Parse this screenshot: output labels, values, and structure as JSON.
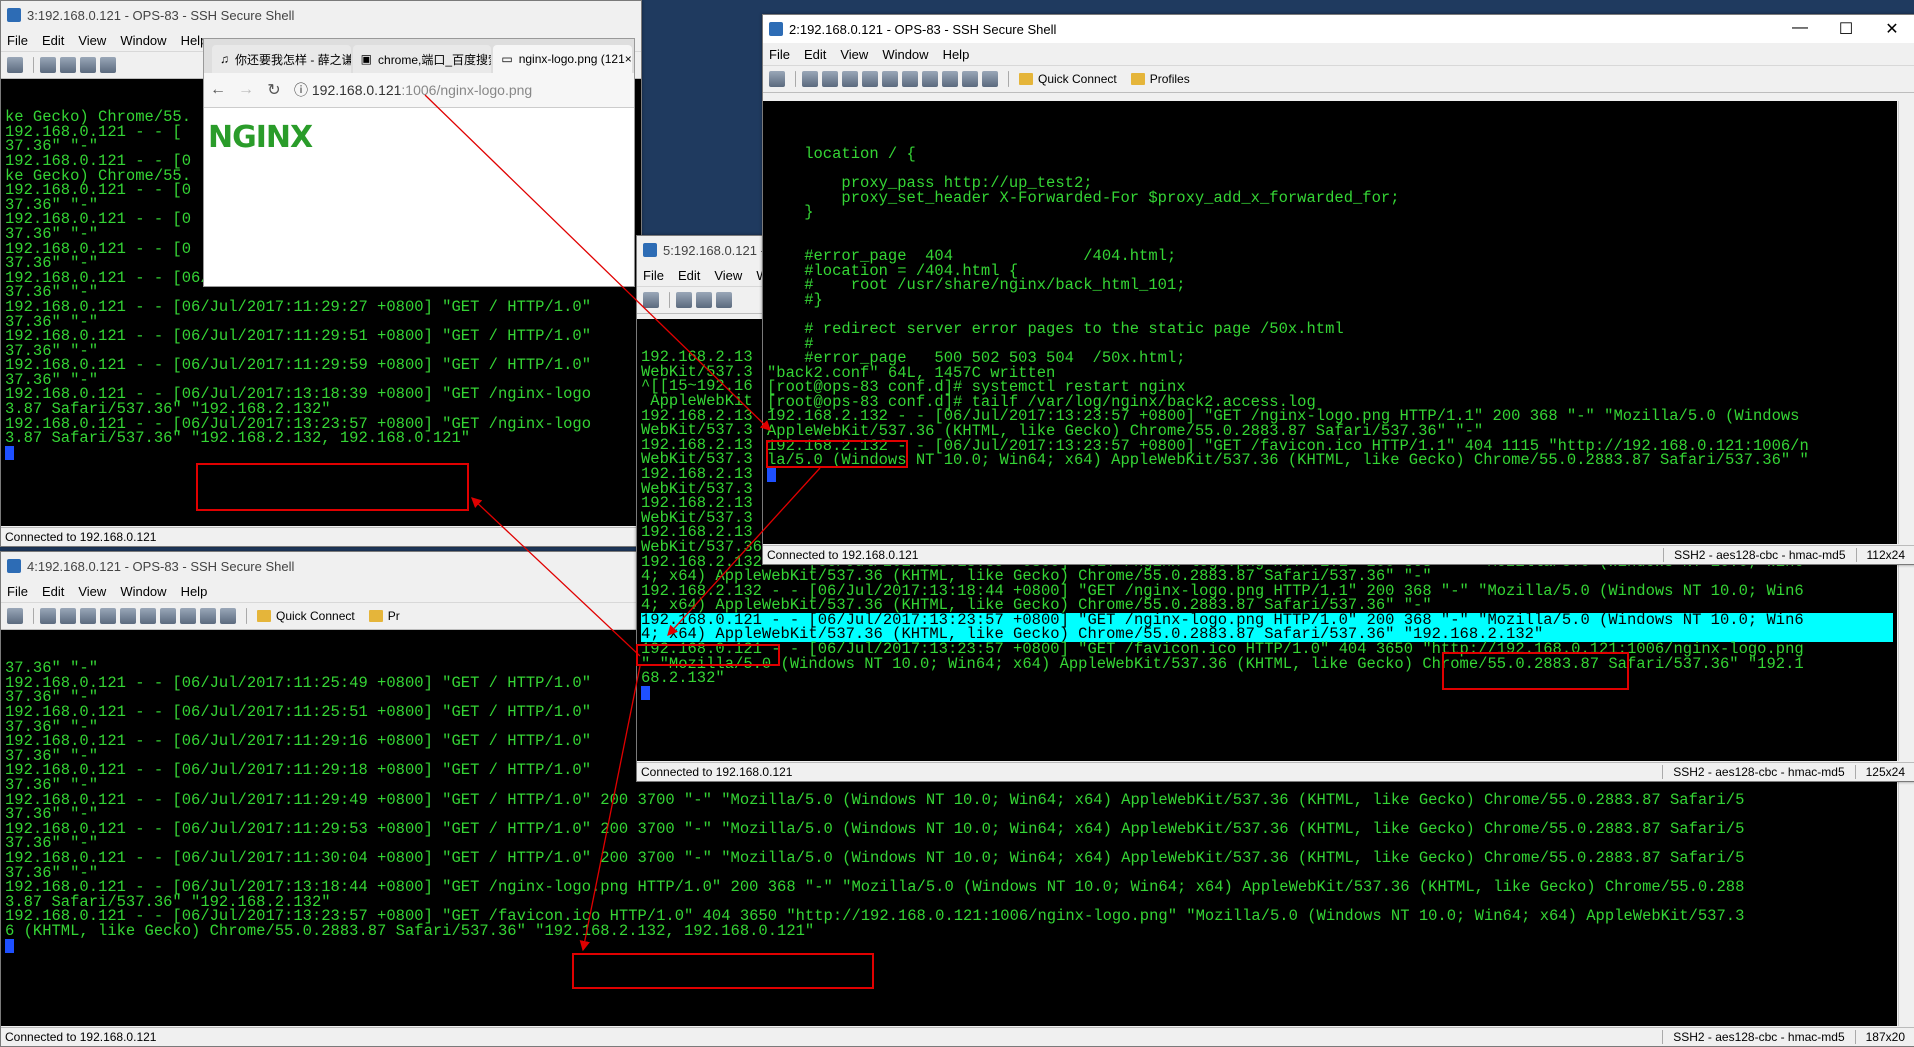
{
  "menus": [
    "File",
    "Edit",
    "View",
    "Window",
    "Help"
  ],
  "toolbar": {
    "quick_connect": "Quick Connect",
    "profiles": "Profiles",
    "profiles_cut": "Pr"
  },
  "win3": {
    "title": "3:192.168.0.121 - OPS-83 - SSH Secure Shell",
    "status": "Connected to 192.168.0.121",
    "lines": [
      "ke Gecko) Chrome/55.",
      "192.168.0.121 - - [",
      "37.36\" \"-\"",
      "192.168.0.121 - - [0",
      "ke Gecko) Chrome/55.",
      "192.168.0.121 - - [0",
      "37.36\" \"-\"",
      "192.168.0.121 - - [0",
      "37.36\" \"-\"",
      "192.168.0.121 - - [0",
      "37.36\" \"-\"",
      "192.168.0.121 - - [06/Jul/2017:11:29:17 +0800] \"GET / HTTP/1.0\"",
      "37.36\" \"-\"",
      "192.168.0.121 - - [06/Jul/2017:11:29:27 +0800] \"GET / HTTP/1.0\"",
      "37.36\" \"-\"",
      "192.168.0.121 - - [06/Jul/2017:11:29:51 +0800] \"GET / HTTP/1.0\"",
      "37.36\" \"-\"",
      "192.168.0.121 - - [06/Jul/2017:11:29:59 +0800] \"GET / HTTP/1.0\"",
      "37.36\" \"-\"",
      "192.168.0.121 - - [06/Jul/2017:13:18:39 +0800] \"GET /nginx-logo",
      "3.87 Safari/537.36\" \"192.168.2.132\"",
      "192.168.0.121 - - [06/Jul/2017:13:23:57 +0800] \"GET /nginx-logo",
      "3.87 Safari/537.36\" \"192.168.2.132, 192.168.0.121\""
    ]
  },
  "chrome": {
    "tabs": [
      "你还要我怎样 - 薛之谦",
      "chrome,端口_百度搜索",
      "nginx-logo.png (121×"
    ],
    "url_host": "192.168.0.121",
    "url_rest": ":1006/nginx-logo.png",
    "logo_text": "NGINX"
  },
  "win2": {
    "title": "2:192.168.0.121 - OPS-83 - SSH Secure Shell",
    "status": "Connected to 192.168.0.121",
    "status_right": [
      "SSH2 - aes128-cbc - hmac-md5",
      "112x24"
    ],
    "lines": [
      "",
      "    location / {",
      "",
      "        proxy_pass http://up_test2;",
      "        proxy_set_header X-Forwarded-For $proxy_add_x_forwarded_for;",
      "    }",
      "",
      "",
      "    #error_page  404              /404.html;",
      "    #location = /404.html {",
      "    #    root /usr/share/nginx/back_html_101;",
      "    #}",
      "",
      "    # redirect server error pages to the static page /50x.html",
      "    #",
      "    #error_page   500 502 503 504  /50x.html;",
      "\"back2.conf\" 64L, 1457C written",
      "[root@ops-83 conf.d]# systemctl restart nginx",
      "[root@ops-83 conf.d]# tailf /var/log/nginx/back2.access.log",
      "192.168.2.132 - - [06/Jul/2017:13:23:57 +0800] \"GET /nginx-logo.png HTTP/1.1\" 200 368 \"-\" \"Mozilla/5.0 (Windows",
      "AppleWebKit/537.36 (KHTML, like Gecko) Chrome/55.0.2883.87 Safari/537.36\" \"-\"",
      "192.168.2.132 - - [06/Jul/2017:13:23:57 +0800] \"GET /favicon.ico HTTP/1.1\" 404 1115 \"http://192.168.0.121:1006/n",
      "la/5.0 (Windows NT 10.0; Win64; x64) AppleWebKit/537.36 (KHTML, like Gecko) Chrome/55.0.2883.87 Safari/537.36\" \""
    ]
  },
  "win5": {
    "title": "5:192.168.0.121 - OPS-83",
    "status": "Connected to 192.168.0.121",
    "status_right": [
      "SSH2 - aes128-cbc - hmac-md5",
      "125x24"
    ],
    "lines": [
      "192.168.2.13",
      "WebKit/537.3",
      "^[[15~192.16",
      " AppleWebKit",
      "192.168.2.13",
      "WebKit/537.3",
      "192.168.2.13",
      "WebKit/537.3",
      "192.168.2.13",
      "WebKit/537.3",
      "192.168.2.13",
      "WebKit/537.3",
      "192.168.2.13",
      "WebKit/537.36 (KHTML, like Gecko) Chrome/55.0.2883.87 Safari/537.36\" \"-\"",
      "192.168.2.132 - - [06/Jul/2017:13:18:39 +0800] \"GET /nginx-logo.png HTTP/1.1\" 200 368 \"-\" \"Mozilla/5.0 (Windows NT 10.0; Win6",
      "4; x64) AppleWebKit/537.36 (KHTML, like Gecko) Chrome/55.0.2883.87 Safari/537.36\" \"-\"",
      "192.168.2.132 - - [06/Jul/2017:13:18:44 +0800] \"GET /nginx-logo.png HTTP/1.1\" 200 368 \"-\" \"Mozilla/5.0 (Windows NT 10.0; Win6",
      "4; x64) AppleWebKit/537.36 (KHTML, like Gecko) Chrome/55.0.2883.87 Safari/537.36\" \"-\"",
      "192.168.0.121 - - [06/Jul/2017:13:23:57 +0800] \"GET /nginx-logo.png HTTP/1.0\" 200 368 \"-\" \"Mozilla/5.0 (Windows NT 10.0; Win6",
      "4; x64) AppleWebKit/537.36 (KHTML, like Gecko) Chrome/55.0.2883.87 Safari/537.36\" \"192.168.2.132\"",
      "192.168.0.121 - - [06/Jul/2017:13:23:57 +0800] \"GET /favicon.ico HTTP/1.0\" 404 3650 \"http://192.168.0.121:1006/nginx-logo.png",
      "\" \"Mozilla/5.0 (Windows NT 10.0; Win64; x64) AppleWebKit/537.36 (KHTML, like Gecko) Chrome/55.0.2883.87 Safari/537.36\" \"192.1",
      "68.2.132\""
    ]
  },
  "win4": {
    "title": "4:192.168.0.121 - OPS-83 - SSH Secure Shell",
    "status": "Connected to 192.168.0.121",
    "status_right": [
      "SSH2 - aes128-cbc - hmac-md5",
      "187x20"
    ],
    "lines": [
      "37.36\" \"-\"",
      "192.168.0.121 - - [06/Jul/2017:11:25:49 +0800] \"GET / HTTP/1.0\"",
      "37.36\" \"-\"",
      "192.168.0.121 - - [06/Jul/2017:11:25:51 +0800] \"GET / HTTP/1.0\"",
      "37.36\" \"-\"",
      "192.168.0.121 - - [06/Jul/2017:11:29:16 +0800] \"GET / HTTP/1.0\"",
      "37.36\" \"-\"",
      "192.168.0.121 - - [06/Jul/2017:11:29:18 +0800] \"GET / HTTP/1.0\"",
      "37.36\" \"-\"",
      "192.168.0.121 - - [06/Jul/2017:11:29:49 +0800] \"GET / HTTP/1.0\" 200 3700 \"-\" \"Mozilla/5.0 (Windows NT 10.0; Win64; x64) AppleWebKit/537.36 (KHTML, like Gecko) Chrome/55.0.2883.87 Safari/5",
      "37.36\" \"-\"",
      "192.168.0.121 - - [06/Jul/2017:11:29:53 +0800] \"GET / HTTP/1.0\" 200 3700 \"-\" \"Mozilla/5.0 (Windows NT 10.0; Win64; x64) AppleWebKit/537.36 (KHTML, like Gecko) Chrome/55.0.2883.87 Safari/5",
      "37.36\" \"-\"",
      "192.168.0.121 - - [06/Jul/2017:11:30:04 +0800] \"GET / HTTP/1.0\" 200 3700 \"-\" \"Mozilla/5.0 (Windows NT 10.0; Win64; x64) AppleWebKit/537.36 (KHTML, like Gecko) Chrome/55.0.2883.87 Safari/5",
      "37.36\" \"-\"",
      "192.168.0.121 - - [06/Jul/2017:13:18:44 +0800] \"GET /nginx-logo.png HTTP/1.0\" 200 368 \"-\" \"Mozilla/5.0 (Windows NT 10.0; Win64; x64) AppleWebKit/537.36 (KHTML, like Gecko) Chrome/55.0.288",
      "3.87 Safari/537.36\" \"192.168.2.132\"",
      "192.168.0.121 - - [06/Jul/2017:13:23:57 +0800] \"GET /favicon.ico HTTP/1.0\" 404 3650 \"http://192.168.0.121:1006/nginx-logo.png\" \"Mozilla/5.0 (Windows NT 10.0; Win64; x64) AppleWebKit/537.3",
      "6 (KHTML, like Gecko) Chrome/55.0.2883.87 Safari/537.36\" \"192.168.2.132, 192.168.0.121\""
    ]
  },
  "colors": {
    "terminal_bg": "#000000",
    "terminal_fg": "#35d535",
    "selection": "#00ffff",
    "annotation": "#e00000"
  }
}
